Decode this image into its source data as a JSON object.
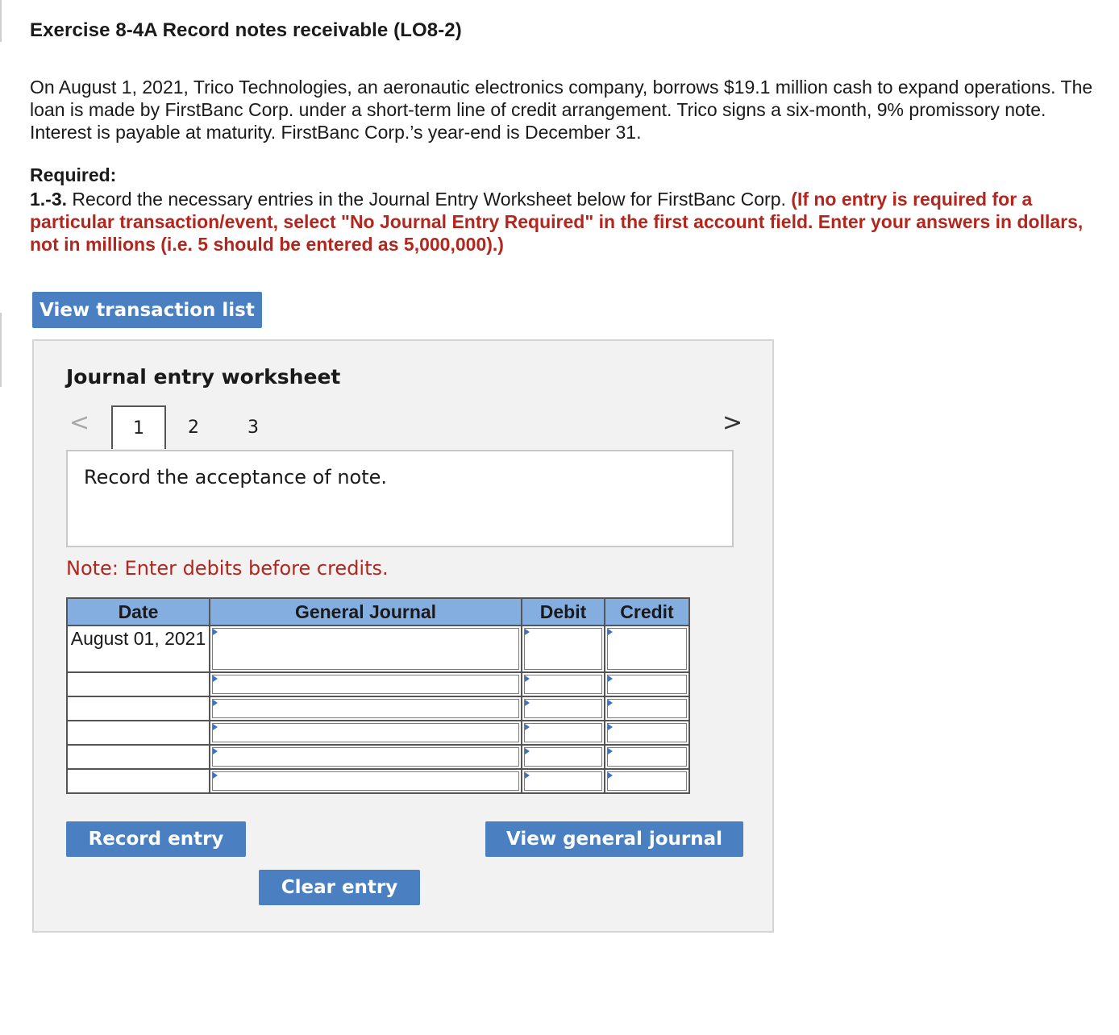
{
  "header": {
    "title": "Exercise 8-4A Record notes receivable (LO8-2)"
  },
  "problem": {
    "paragraph": "On August 1, 2021, Trico Technologies, an aeronautic electronics company, borrows $19.1 million cash to expand operations. The loan is made by FirstBanc Corp. under a short-term line of credit arrangement. Trico signs a six-month, 9% promissory note. Interest is payable at maturity. FirstBanc Corp.’s year-end is December 31.",
    "required_label": "Required:",
    "req_number": "1.-3.",
    "req_text": " Record the necessary entries in the Journal Entry Worksheet below for FirstBanc Corp. ",
    "req_instruction": "(If no entry is required for a particular transaction/event, select \"No Journal Entry Required\" in the first account field. Enter your answers in dollars, not in millions (i.e. 5 should be entered as 5,000,000).)"
  },
  "buttons": {
    "view_transaction_list": "View transaction list",
    "record_entry": "Record entry",
    "view_general_journal": "View general journal",
    "clear_entry": "Clear entry"
  },
  "worksheet": {
    "title": "Journal entry worksheet",
    "nav_prev": "<",
    "nav_next": ">",
    "tabs": [
      "1",
      "2",
      "3"
    ],
    "active_tab": "1",
    "description": "Record the acceptance of note.",
    "note": "Note: Enter debits before credits."
  },
  "journal_table": {
    "headers": [
      "Date",
      "General Journal",
      "Debit",
      "Credit"
    ],
    "first_row_date": "August 01, 2021"
  },
  "colors": {
    "button_blue": "#4a7fc1",
    "header_blue": "#85aee0",
    "instruction_red": "#b3261e",
    "panel_gray": "#f2f2f2"
  }
}
